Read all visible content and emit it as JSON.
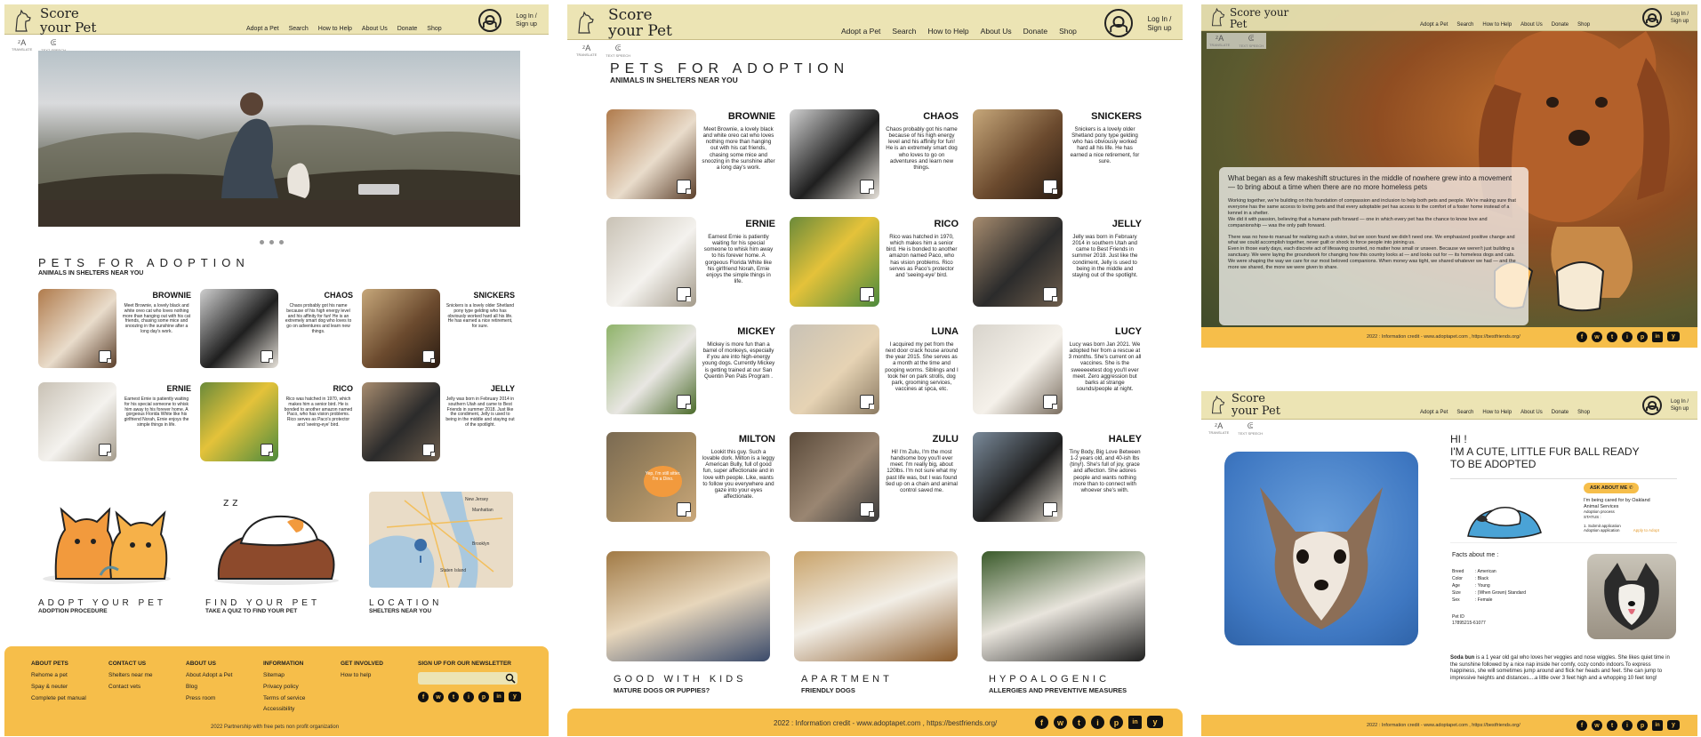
{
  "brand": "Score your Pet",
  "nav": [
    "Adopt a Pet",
    "Search",
    "How to Help",
    "About Us",
    "Donate",
    "Shop"
  ],
  "login": "Log In / Sign up",
  "controls": {
    "translate": "TRANSLATE",
    "text_speech": "TEXT SPEECH"
  },
  "home": {
    "title": "PETS FOR ADOPTION",
    "subtitle": "ANIMALS IN SHELTERS NEAR YOU",
    "categories": [
      {
        "title": "ADOPT YOUR PET",
        "sub": "ADOPTION PROCEDURE"
      },
      {
        "title": "FIND YOUR PET",
        "sub": "TAKE A QUIZ TO FIND YOUR PET"
      },
      {
        "title": "LOCATION",
        "sub": "SHELTERS NEAR YOU"
      }
    ],
    "map_labels": [
      "New Jersey",
      "Manhattan",
      "Brooklyn",
      "Staten Island"
    ],
    "footer_cols": [
      {
        "head": "ABOUT PETS",
        "links": [
          "Rehome a pet",
          "Spay & neuter",
          "Complete pet manual"
        ]
      },
      {
        "head": "CONTACT US",
        "links": [
          "Shelters near me",
          "Contact vets"
        ]
      },
      {
        "head": "ABOUT US",
        "links": [
          "About Adopt a Pet",
          "Blog",
          "Press room"
        ]
      },
      {
        "head": "INFORMATION",
        "links": [
          "Sitemap",
          "Privacy policy",
          "Terms of service",
          "Accessibility"
        ]
      },
      {
        "head": "GET INVOLVED",
        "links": [
          "How to help"
        ]
      }
    ],
    "newsletter": "SIGN UP FOR OUR NEWSLETTER",
    "copyright": "2022 Partnership with free pets non profit organization"
  },
  "pets": [
    {
      "name": "BROWNIE",
      "desc": "Meet Brownie, a lovely black and white oreo cat who loves nothing more than hanging out with his cat friends, chasing some mice and snoozing in the sunshine after a long day's work."
    },
    {
      "name": "CHAOS",
      "desc": "Chaos probably got his name because of his high energy level and his affinity for fun! He is an extremely smart dog who loves to go on adventures and learn new things."
    },
    {
      "name": "SNICKERS",
      "desc": "Snickers is a lovely older Shetland pony type gelding who has obviously worked hard all his life. He has earned a nice retirement, for sure."
    },
    {
      "name": "ERNIE",
      "desc": "Earnest Ernie is patiently waiting for his special someone to whisk him away to his forever home. A gorgeous Florida White like his girlfriend Norah, Ernie enjoys the simple things in life."
    },
    {
      "name": "RICO",
      "desc": "Rico was hatched in 1970, which makes him a senior bird. He is bonded to another amazon named Paco, who has vision problems. Rico serves as Paco's protector and 'seeing-eye' bird."
    },
    {
      "name": "JELLY",
      "desc": "Jelly was born in February 2014 in southern Utah and came to Best Friends in summer 2018. Just like the condiment, Jelly is used to being in the middle and staying out of the spotlight."
    },
    {
      "name": "MICKEY",
      "desc": "Mickey is more fun than a barrel of monkeys, especially if you are into high-energy young dogs. Currently Mickey is getting trained at our San Quentin Pen Pals Program ."
    },
    {
      "name": "LUNA",
      "desc": "I acquired my pet from the next door crack house around the year 2015. She serves as a month at the time and pooping worms. Siblings and I took her on park strolls, dog park, grooming services, vaccines at spca, etc."
    },
    {
      "name": "LUCY",
      "desc": "Lucy was born Jan 2021. We adopted her from a rescue at 3 months. She's current on all vaccines. She is the sweeeeetest dog you'll ever meet. Zero aggression but barks at strange sounds/people at night."
    },
    {
      "name": "MILTON",
      "desc": "Lookit this guy. Such a lovable dork. Milton is a leggy American Bully, full of good fun, super affectionate and in love with people. Like, wants to follow you everywhere and gaze into your eyes affectionate."
    },
    {
      "name": "ZULU",
      "desc": "Hi! I'm Zulu, I'm the most handsome boy you'll ever meet. I'm really big, about 120lbs. I'm not sure what my past life was, but I was found tied up on a chain and animal control saved me."
    },
    {
      "name": "HALEY",
      "desc": "Tiny Body, Big Love Between 1-2 years old, and 40-ish lbs (tiny!). She's full of joy, grace and affection. She adores people and wants nothing more than to connect with whoever she's with."
    }
  ],
  "milton_sign": "Yep, I'm still sitter. I'm a Dino.",
  "adoption": {
    "title": "PETS FOR ADOPTION",
    "subtitle": "ANIMALS IN SHELTERS NEAR YOU",
    "categories": [
      {
        "title": "GOOD WITH KIDS",
        "sub": "MATURE DOGS OR PUPPIES?"
      },
      {
        "title": "APARTMENT",
        "sub": "FRIENDLY DOGS"
      },
      {
        "title": "HYPOALOGENIC",
        "sub": "ALLERGIES AND PREVENTIVE MEASURES"
      }
    ],
    "footer": "2022 : Information credit - www.adoptapet.com , https://bestfriends.org/"
  },
  "about": {
    "lead": "What began as a few makeshift structures in the middle of nowhere grew into a movement — to bring about a time when there are no more homeless pets",
    "p1": "Working together, we're building on this foundation of compassion and inclusion to help both pets and people. We're making sure that everyone has the same access to loving pets and that every adoptable pet has access to the comfort of a foster home instead of a kennel in a shelter.",
    "p2": "We did it with passion, believing that a humane path forward — one in which every pet has the chance to know love and companionship — was the only path forward.",
    "p3": "There was no how-to manual for realizing such a vision, but we soon found we didn't need one. We emphasized positive change and what we could accomplish together, never guilt or shock to force people into joining us.",
    "p4": "Even in those early days, each discrete act of lifesaving counted, no matter how small or unseen. Because we weren't just building a sanctuary. We were laying the groundwork for changing how this country looks at — and looks out for — its homeless dogs and cats. We were shaping the way we care for our most beloved companions. When money was tight, we shared whatever we had — and the more we shared, the more we were given to share.",
    "footer": "2022 : Information credit - www.adoptapet.com , https://bestfriends.org/"
  },
  "profile": {
    "hi": "HI !",
    "line2": "I'M A CUTE, LITTLE FUR BALL READY",
    "line3": "TO BE ADOPTED",
    "ask": "ASK ABOUT ME",
    "cared": "I'm being cared for by Oakland Animal Services",
    "process": "Adoption process",
    "status": "STATUS :",
    "step1": "1. Submit application",
    "step2": "Adoption application",
    "apply": "Apply to Adopt",
    "facts_title": "Facts about me :",
    "facts": [
      {
        "k": "Breed",
        "v": "American"
      },
      {
        "k": "Color",
        "v": "Black"
      },
      {
        "k": "Age",
        "v": "Young"
      },
      {
        "k": "Size",
        "v": "(When Grown) Standard"
      },
      {
        "k": "Sex",
        "v": "Female"
      }
    ],
    "pet_id_label": "Pet ID",
    "pet_id": "17895215-61077",
    "bio_name": "Soda bun",
    "bio": " is a 1 year old gal who loves her veggies and nose wiggles. She likes quiet time in the sunshine followed by a nice nap inside her comfy, cozy condo indoors.To express happiness, she will sometimes jump around and flick her heads and feet. She can jump to impressive heights and distances....a little over 3 feet high and a whopping 10 feet long!",
    "footer": "2022 : Information credit - www.adoptapet.com , https://bestfriends.org/"
  },
  "social": [
    "f",
    "w",
    "t",
    "i",
    "p",
    "in",
    "y"
  ]
}
